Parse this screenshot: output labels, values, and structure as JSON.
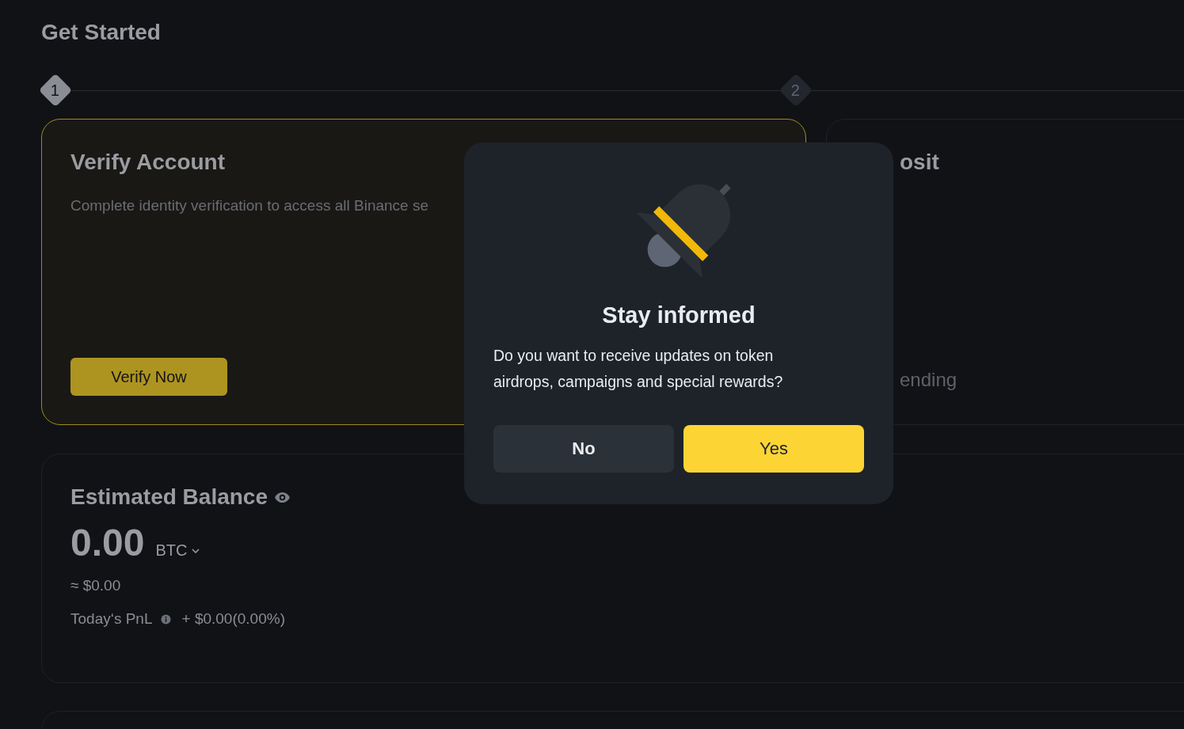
{
  "page_title": "Get Started",
  "steps": [
    {
      "number": "1",
      "selected": true
    },
    {
      "number": "2",
      "selected": false
    }
  ],
  "cards": [
    {
      "title": "Verify Account",
      "description": "Complete identity verification to access all Binance se",
      "button": "Verify Now",
      "selected": true
    },
    {
      "title": "osit",
      "status": "ending",
      "selected": false
    }
  ],
  "balance": {
    "title": "Estimated Balance",
    "amount": "0.00",
    "currency": "BTC",
    "fiat": "≈ $0.00",
    "pnl_label": "Today‘s PnL",
    "pnl_value": "+ $0.00(0.00%)"
  },
  "dialog": {
    "title": "Stay informed",
    "message": "Do you want to receive updates on token airdrops, campaigns and special rewards?",
    "buttons": [
      {
        "label": "No",
        "kind": "secondary"
      },
      {
        "label": "Yes",
        "kind": "primary"
      }
    ]
  }
}
